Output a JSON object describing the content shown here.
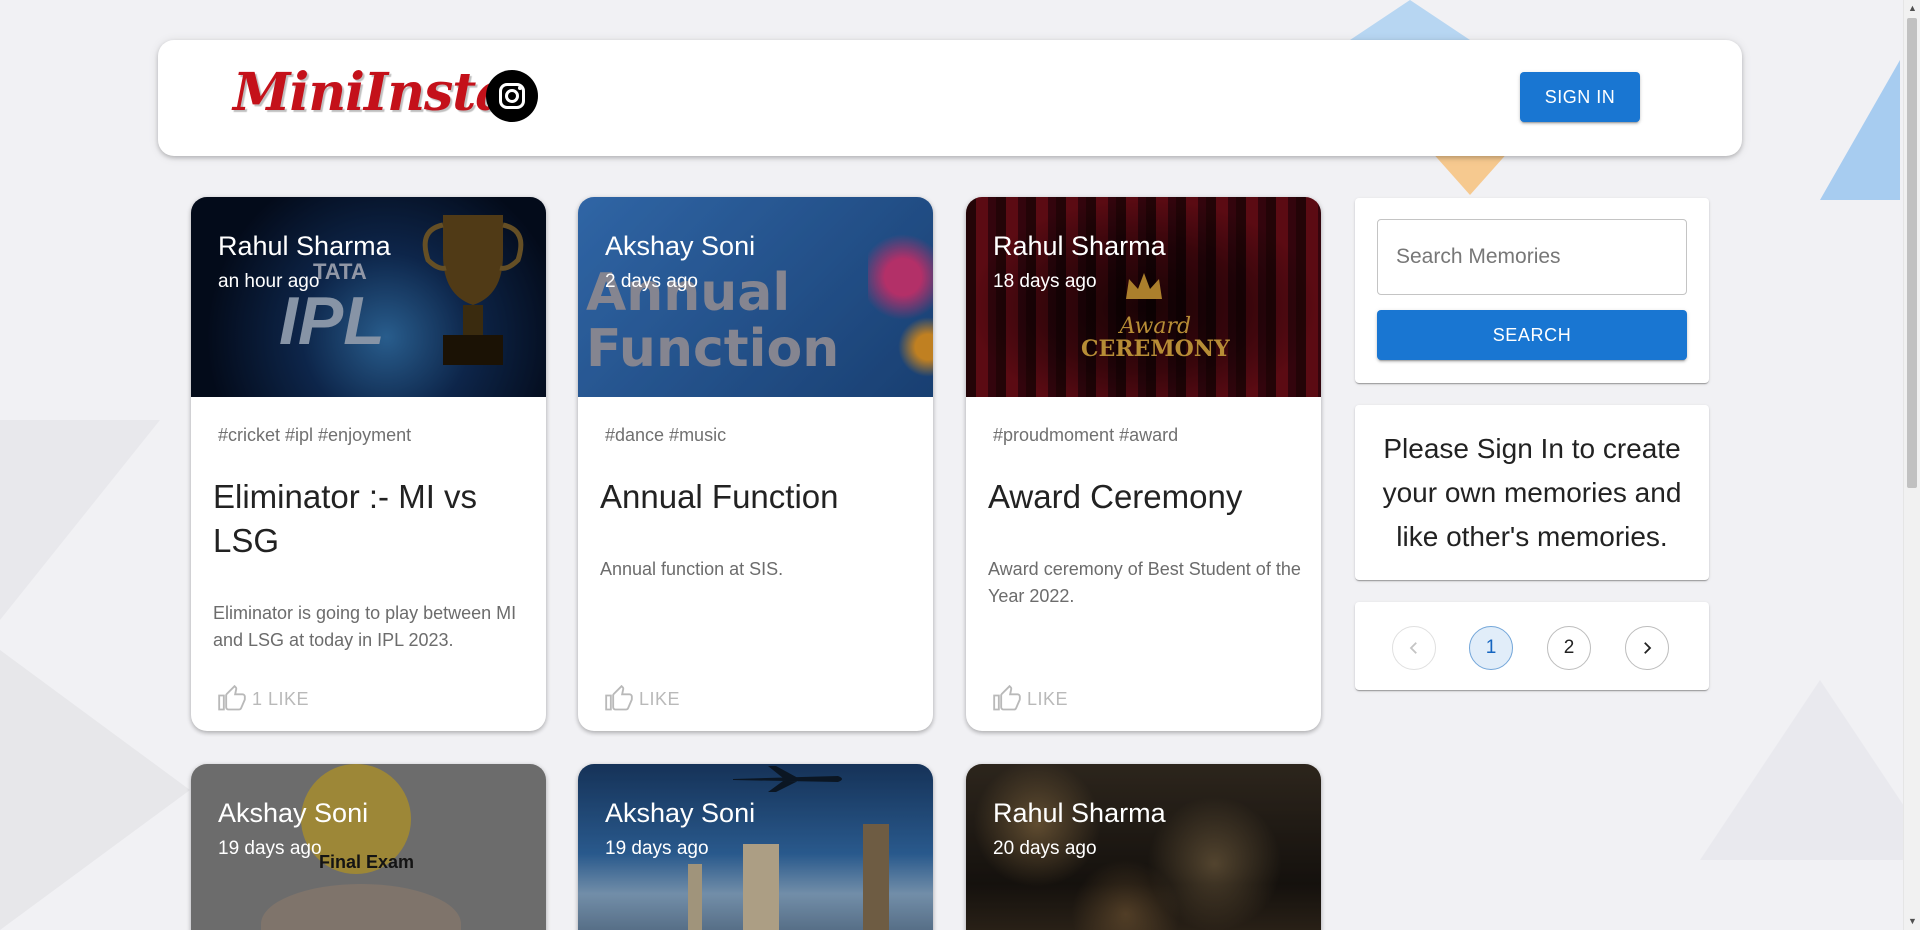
{
  "header": {
    "logo_text": "MiniInsta",
    "signin_label": "SIGN IN"
  },
  "posts": [
    {
      "creator": "Rahul Sharma",
      "time": "an hour ago",
      "tags": "#cricket #ipl #enjoyment",
      "title": "Eliminator :- MI vs LSG",
      "message": "Eliminator is going to play between MI and LSG at today in IPL 2023.",
      "like_label": "1 LIKE",
      "image_text": [
        "TATA",
        "IPL"
      ]
    },
    {
      "creator": "Akshay Soni",
      "time": "2 days ago",
      "tags": "#dance #music",
      "title": "Annual Function",
      "message": "Annual function at SIS.",
      "like_label": "LIKE",
      "image_text": [
        "Annual",
        "Function"
      ]
    },
    {
      "creator": "Rahul Sharma",
      "time": "18 days ago",
      "tags": "#proudmoment #award",
      "title": "Award Ceremony",
      "message": "Award ceremony of Best Student of the Year 2022.",
      "like_label": "LIKE",
      "image_text": [
        "Award",
        "CEREMONY"
      ]
    },
    {
      "creator": "Akshay Soni",
      "time": "19 days ago",
      "image_text": [
        "Final Exam"
      ]
    },
    {
      "creator": "Akshay Soni",
      "time": "19 days ago"
    },
    {
      "creator": "Rahul Sharma",
      "time": "20 days ago"
    }
  ],
  "sidebar": {
    "search_placeholder": "Search Memories",
    "search_label": "SEARCH",
    "notice": "Please Sign In to create your own memories and like other's memories.",
    "pagination": {
      "pages": [
        "1",
        "2"
      ],
      "current": "1"
    }
  },
  "colors": {
    "primary": "#1976d2",
    "logo": "#c4111a",
    "background": "#f1f1f4"
  }
}
